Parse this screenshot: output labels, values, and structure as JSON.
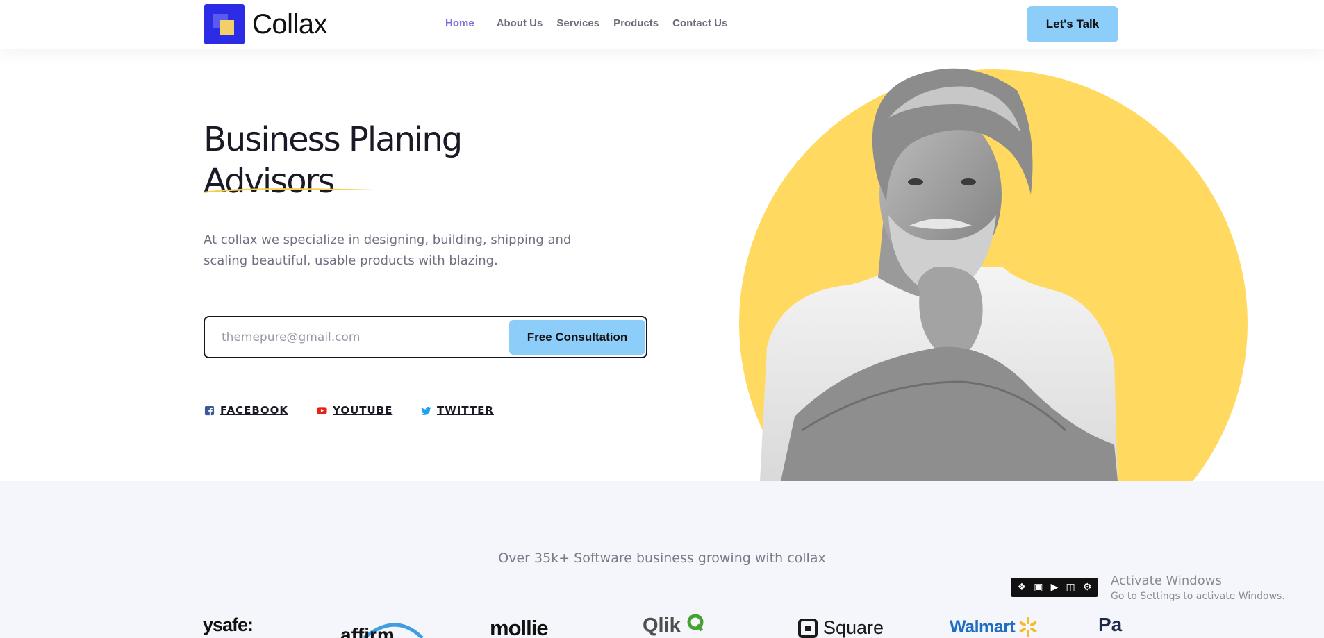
{
  "brand": {
    "name": "Collax"
  },
  "nav": {
    "items": [
      {
        "label": "Home",
        "active": true
      },
      {
        "label": "About Us",
        "active": false
      },
      {
        "label": "Services",
        "active": false
      },
      {
        "label": "Products",
        "active": false
      },
      {
        "label": "Contact Us",
        "active": false
      }
    ],
    "cta_label": "Let's Talk"
  },
  "hero": {
    "title_line1": "Business Planing",
    "title_line2": "Advisors",
    "subtitle": "At collax we specialize in designing, building, shipping and scaling beautiful, usable products with blazing.",
    "email_placeholder": "themepure@gmail.com",
    "email_value": "",
    "submit_label": "Free Consultation"
  },
  "social": [
    {
      "label": "FACEBOOK",
      "icon": "facebook-icon"
    },
    {
      "label": "YOUTUBE",
      "icon": "youtube-icon"
    },
    {
      "label": "TWITTER",
      "icon": "twitter-icon"
    }
  ],
  "partners": {
    "title": "Over 35k+ Software business growing with collax",
    "brands": [
      "ysafe:",
      "affirm",
      "mollie",
      "Qlik",
      "Square",
      "Walmart",
      "Pa"
    ]
  },
  "os_overlay": {
    "activate_title": "Activate Windows",
    "activate_sub": "Go to Settings to activate Windows."
  },
  "colors": {
    "accent_blue": "#8dcdf9",
    "logo_blue": "#2c2ce6",
    "yellow": "#ffd960",
    "nav_active": "#7c6fd8",
    "band_bg": "#f5f6fb"
  }
}
